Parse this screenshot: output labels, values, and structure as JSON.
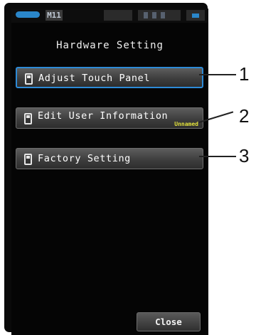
{
  "status_bar": {
    "segment_label": "M11",
    "mode_color": "#2a86c9"
  },
  "screen": {
    "title": "Hardware Setting"
  },
  "menu": [
    {
      "label": "Adjust Touch Panel",
      "sublabel": "",
      "selected": true,
      "icon": "device-icon"
    },
    {
      "label": "Edit User Information",
      "sublabel": "Unnamed",
      "selected": false,
      "icon": "device-icon"
    },
    {
      "label": "Factory Setting",
      "sublabel": "",
      "selected": false,
      "icon": "device-icon"
    }
  ],
  "footer": {
    "close_label": "Close"
  },
  "callouts": [
    "1",
    "2",
    "3"
  ],
  "colors": {
    "selection": "#2d8ad6",
    "sublabel": "#e1e03c",
    "screen_bg": "#050505"
  }
}
